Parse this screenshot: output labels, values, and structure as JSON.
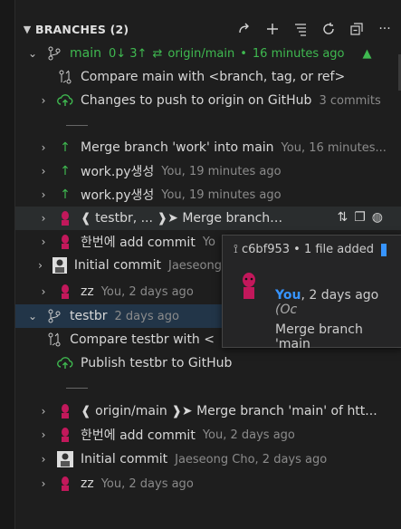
{
  "header": {
    "title": "BRANCHES (2)"
  },
  "branch_main": {
    "name": "main",
    "sync": "0↓ 3↑",
    "remote": "origin/main",
    "time": "16 minutes ago"
  },
  "main_items": {
    "compare": "Compare main with <branch, tag, or ref>",
    "changes": "Changes to push to origin on GitHub",
    "changes_count": "3 commits"
  },
  "main_commits": [
    {
      "msg": "Merge branch 'work' into main",
      "desc": "You, 16 minutes..."
    },
    {
      "msg": "work.py생성",
      "desc": "You, 19 minutes ago"
    },
    {
      "msg": "work.py생성",
      "desc": "You, 19 minutes ago"
    },
    {
      "msg": "❰ testbr, ... ❱➤ Merge branch 'main...",
      "desc": ""
    },
    {
      "msg": "한번에 add commit",
      "desc": "Yo"
    },
    {
      "msg": "Initial commit",
      "desc": "Jaeseong"
    },
    {
      "msg": "zz",
      "desc": "You, 2 days ago"
    }
  ],
  "branch_testbr": {
    "name": "testbr",
    "time": "2 days ago"
  },
  "testbr_items": {
    "compare": "Compare testbr with <",
    "publish": "Publish testbr to GitHub"
  },
  "testbr_commits": [
    {
      "msg": "❰ origin/main ❱➤ Merge branch 'main' of htt...",
      "desc": ""
    },
    {
      "msg": "한번에 add commit",
      "desc": "You, 2 days ago"
    },
    {
      "msg": "Initial commit",
      "desc": "Jaeseong Cho, 2 days ago"
    },
    {
      "msg": "zz",
      "desc": "You, 2 days ago"
    }
  ],
  "hover": {
    "commit": "c6bf953 • 1 file added",
    "author": "You",
    "time": ", 2 days ago",
    "extra": "(Oc",
    "message": "Merge branch 'main"
  },
  "colors": {
    "accent": "#3794ff",
    "green": "#3fb950",
    "bg": "#1e1e1e"
  }
}
